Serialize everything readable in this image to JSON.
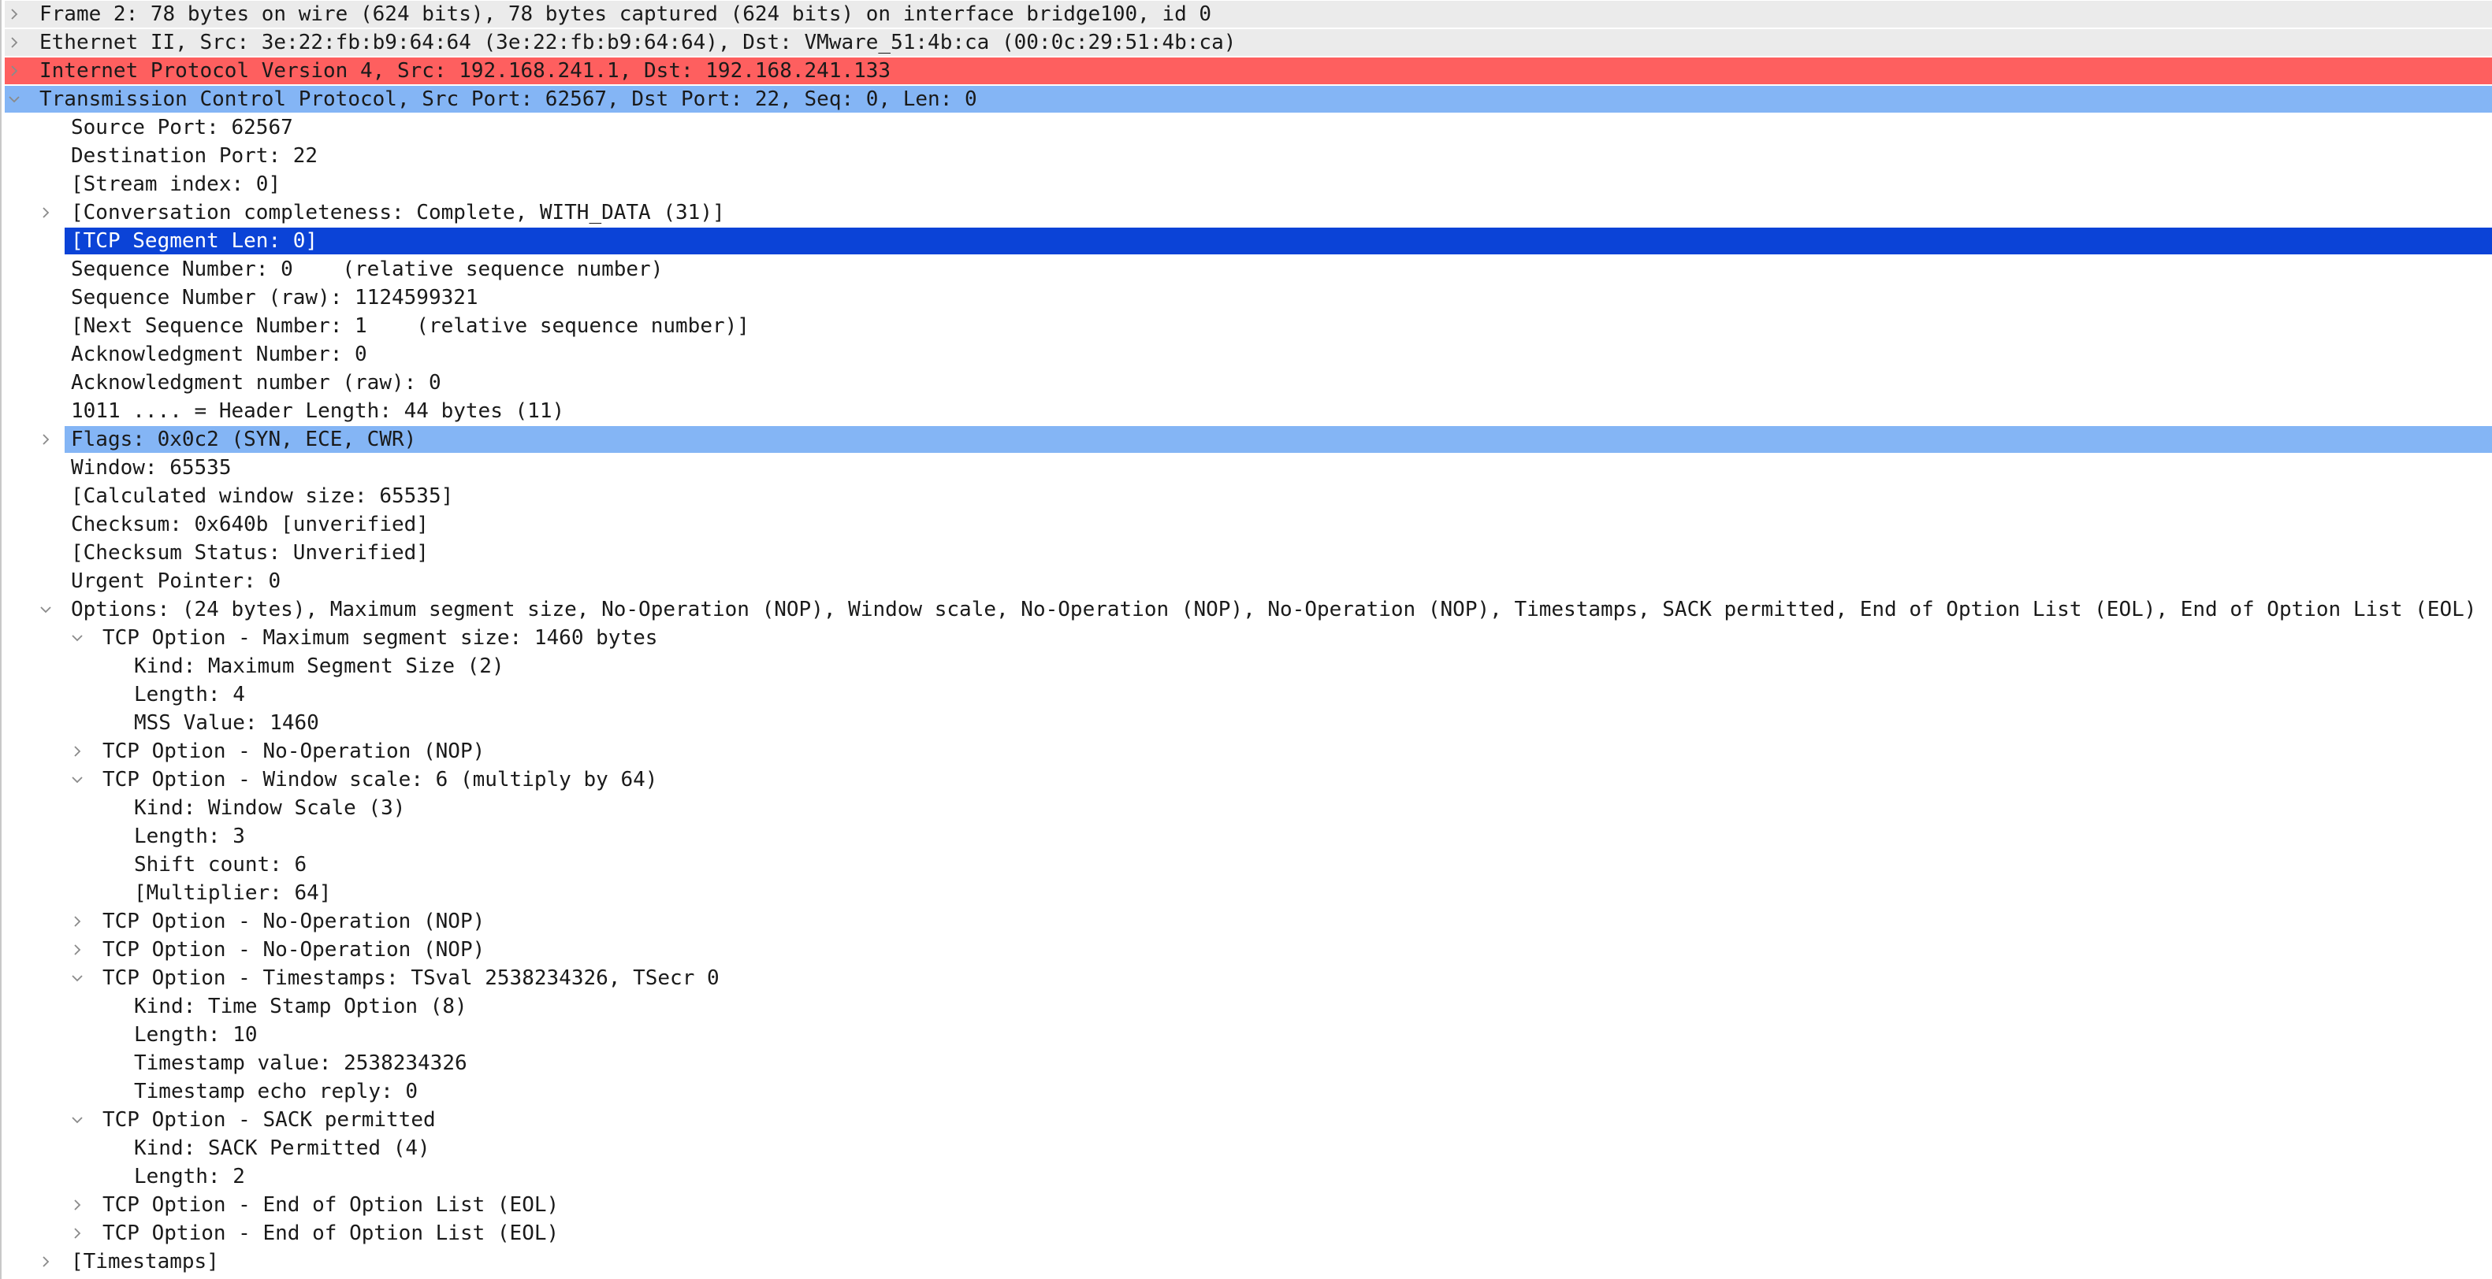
{
  "colors": {
    "protocol_ipv4": "#fe5f5f",
    "protocol_tcp": "#84b5f5",
    "selection": "#0b43d7",
    "frame_row": "#ebebeb",
    "text": "#1a1a1a",
    "selected_text": "#ffffff"
  },
  "tree": [
    {
      "label": "Frame 2: 78 bytes on wire (624 bits), 78 bytes captured (624 bits) on interface bridge100, id 0",
      "depth": 0,
      "arrow": "right",
      "style": "grey"
    },
    {
      "label": "Ethernet II, Src: 3e:22:fb:b9:64:64 (3e:22:fb:b9:64:64), Dst: VMware_51:4b:ca (00:0c:29:51:4b:ca)",
      "depth": 0,
      "arrow": "right",
      "style": "grey"
    },
    {
      "label": "Internet Protocol Version 4, Src: 192.168.241.1, Dst: 192.168.241.133",
      "depth": 0,
      "arrow": "right",
      "style": "red"
    },
    {
      "label": "Transmission Control Protocol, Src Port: 62567, Dst Port: 22, Seq: 0, Len: 0",
      "depth": 0,
      "arrow": "down",
      "style": "lightblue"
    },
    {
      "label": "Source Port: 62567",
      "depth": 1,
      "arrow": "none",
      "style": ""
    },
    {
      "label": "Destination Port: 22",
      "depth": 1,
      "arrow": "none",
      "style": ""
    },
    {
      "label": "[Stream index: 0]",
      "depth": 1,
      "arrow": "none",
      "style": ""
    },
    {
      "label": "[Conversation completeness: Complete, WITH_DATA (31)]",
      "depth": 1,
      "arrow": "right",
      "style": ""
    },
    {
      "label": "[TCP Segment Len: 0]",
      "depth": 1,
      "arrow": "none",
      "style": "selected"
    },
    {
      "label": "Sequence Number: 0    (relative sequence number)",
      "depth": 1,
      "arrow": "none",
      "style": ""
    },
    {
      "label": "Sequence Number (raw): 1124599321",
      "depth": 1,
      "arrow": "none",
      "style": ""
    },
    {
      "label": "[Next Sequence Number: 1    (relative sequence number)]",
      "depth": 1,
      "arrow": "none",
      "style": ""
    },
    {
      "label": "Acknowledgment Number: 0",
      "depth": 1,
      "arrow": "none",
      "style": ""
    },
    {
      "label": "Acknowledgment number (raw): 0",
      "depth": 1,
      "arrow": "none",
      "style": ""
    },
    {
      "label": "1011 .... = Header Length: 44 bytes (11)",
      "depth": 1,
      "arrow": "none",
      "style": ""
    },
    {
      "label": "Flags: 0x0c2 (SYN, ECE, CWR)",
      "depth": 1,
      "arrow": "right",
      "style": "lightblue"
    },
    {
      "label": "Window: 65535",
      "depth": 1,
      "arrow": "none",
      "style": ""
    },
    {
      "label": "[Calculated window size: 65535]",
      "depth": 1,
      "arrow": "none",
      "style": ""
    },
    {
      "label": "Checksum: 0x640b [unverified]",
      "depth": 1,
      "arrow": "none",
      "style": ""
    },
    {
      "label": "[Checksum Status: Unverified]",
      "depth": 1,
      "arrow": "none",
      "style": ""
    },
    {
      "label": "Urgent Pointer: 0",
      "depth": 1,
      "arrow": "none",
      "style": ""
    },
    {
      "label": "Options: (24 bytes), Maximum segment size, No-Operation (NOP), Window scale, No-Operation (NOP), No-Operation (NOP), Timestamps, SACK permitted, End of Option List (EOL), End of Option List (EOL)",
      "depth": 1,
      "arrow": "down",
      "style": ""
    },
    {
      "label": "TCP Option - Maximum segment size: 1460 bytes",
      "depth": 2,
      "arrow": "down",
      "style": ""
    },
    {
      "label": "Kind: Maximum Segment Size (2)",
      "depth": 3,
      "arrow": "none",
      "style": ""
    },
    {
      "label": "Length: 4",
      "depth": 3,
      "arrow": "none",
      "style": ""
    },
    {
      "label": "MSS Value: 1460",
      "depth": 3,
      "arrow": "none",
      "style": ""
    },
    {
      "label": "TCP Option - No-Operation (NOP)",
      "depth": 2,
      "arrow": "right",
      "style": ""
    },
    {
      "label": "TCP Option - Window scale: 6 (multiply by 64)",
      "depth": 2,
      "arrow": "down",
      "style": ""
    },
    {
      "label": "Kind: Window Scale (3)",
      "depth": 3,
      "arrow": "none",
      "style": ""
    },
    {
      "label": "Length: 3",
      "depth": 3,
      "arrow": "none",
      "style": ""
    },
    {
      "label": "Shift count: 6",
      "depth": 3,
      "arrow": "none",
      "style": ""
    },
    {
      "label": "[Multiplier: 64]",
      "depth": 3,
      "arrow": "none",
      "style": ""
    },
    {
      "label": "TCP Option - No-Operation (NOP)",
      "depth": 2,
      "arrow": "right",
      "style": ""
    },
    {
      "label": "TCP Option - No-Operation (NOP)",
      "depth": 2,
      "arrow": "right",
      "style": ""
    },
    {
      "label": "TCP Option - Timestamps: TSval 2538234326, TSecr 0",
      "depth": 2,
      "arrow": "down",
      "style": ""
    },
    {
      "label": "Kind: Time Stamp Option (8)",
      "depth": 3,
      "arrow": "none",
      "style": ""
    },
    {
      "label": "Length: 10",
      "depth": 3,
      "arrow": "none",
      "style": ""
    },
    {
      "label": "Timestamp value: 2538234326",
      "depth": 3,
      "arrow": "none",
      "style": ""
    },
    {
      "label": "Timestamp echo reply: 0",
      "depth": 3,
      "arrow": "none",
      "style": ""
    },
    {
      "label": "TCP Option - SACK permitted",
      "depth": 2,
      "arrow": "down",
      "style": ""
    },
    {
      "label": "Kind: SACK Permitted (4)",
      "depth": 3,
      "arrow": "none",
      "style": ""
    },
    {
      "label": "Length: 2",
      "depth": 3,
      "arrow": "none",
      "style": ""
    },
    {
      "label": "TCP Option - End of Option List (EOL)",
      "depth": 2,
      "arrow": "right",
      "style": ""
    },
    {
      "label": "TCP Option - End of Option List (EOL)",
      "depth": 2,
      "arrow": "right",
      "style": ""
    },
    {
      "label": "[Timestamps]",
      "depth": 1,
      "arrow": "right",
      "style": ""
    }
  ]
}
